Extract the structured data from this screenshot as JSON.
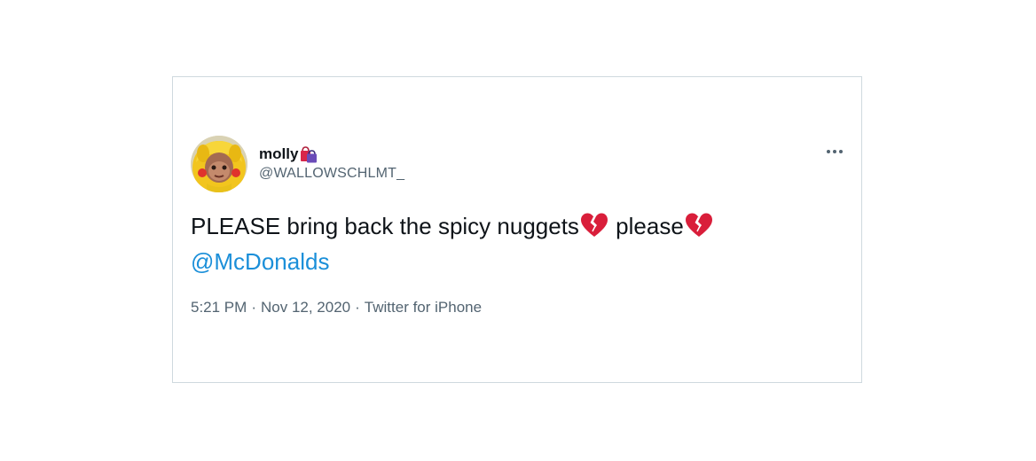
{
  "tweet": {
    "author": {
      "display_name": "molly",
      "name_emoji": "shopping-bags-emoji",
      "handle": "@WALLOWSCHLMT_",
      "avatar": "profile-photo"
    },
    "more_icon": "more-options-icon",
    "text": {
      "part1": "PLEASE bring back the spicy nuggets",
      "emoji1": "broken-heart-emoji",
      "part2": " please",
      "emoji2": "broken-heart-emoji",
      "mention": "@McDonalds"
    },
    "meta": {
      "time": "5:21 PM",
      "separator": "·",
      "date": "Nov 12, 2020",
      "source": "Twitter for iPhone"
    }
  },
  "colors": {
    "text": "#0f1419",
    "secondary": "#536471",
    "link": "#1b8fd9",
    "border": "#cfd9de",
    "heart": "#d91e3a"
  }
}
